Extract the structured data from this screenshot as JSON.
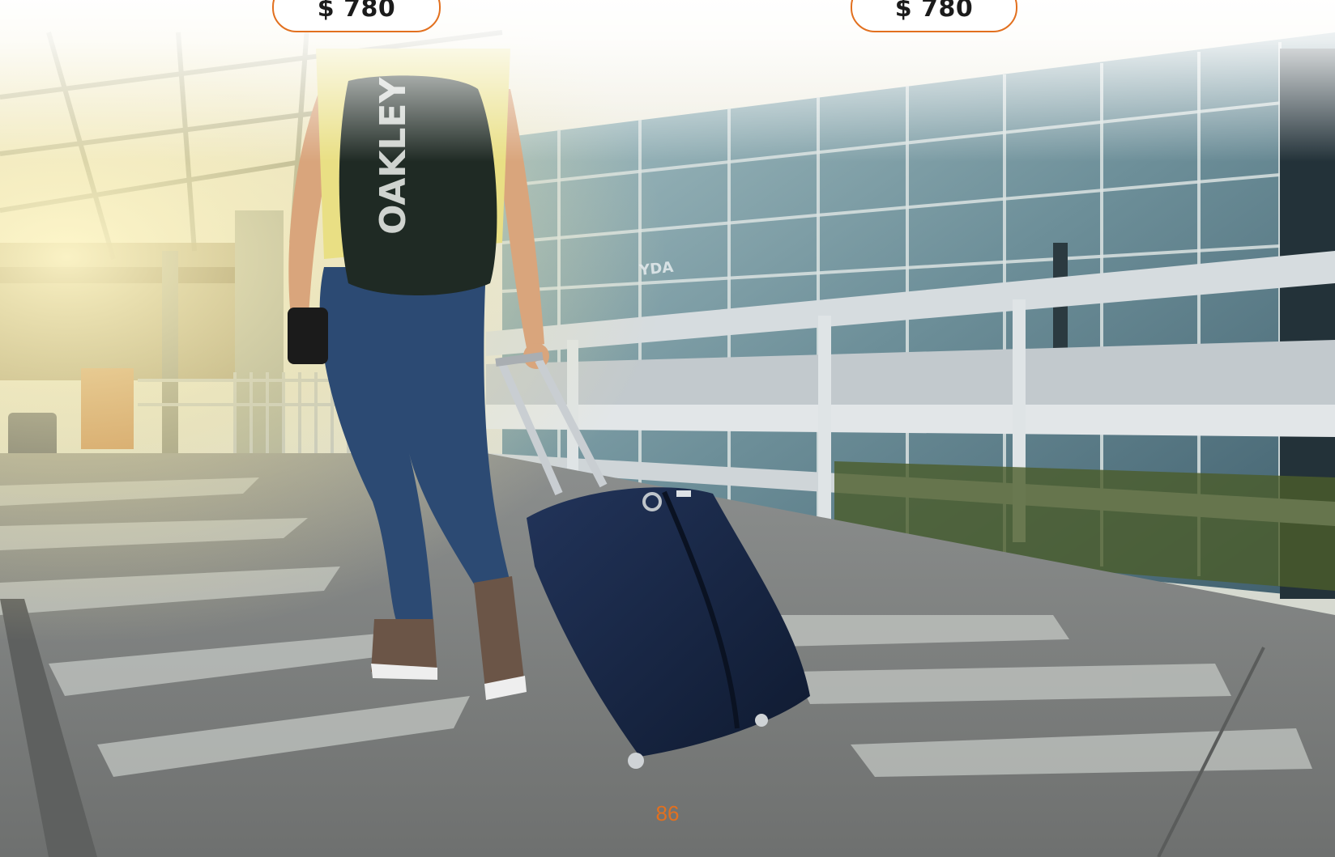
{
  "prices": {
    "left": "$ 780",
    "right": "$ 780"
  },
  "page_number": "86",
  "colors": {
    "accent": "#e2701f",
    "text": "#1b1b1b",
    "suitcase": "#15233e",
    "jeans": "#2c4a73",
    "glass": "#5a7e8e"
  },
  "photo": {
    "backpack_text": "OAKLEY",
    "sign_text": "YDA"
  }
}
